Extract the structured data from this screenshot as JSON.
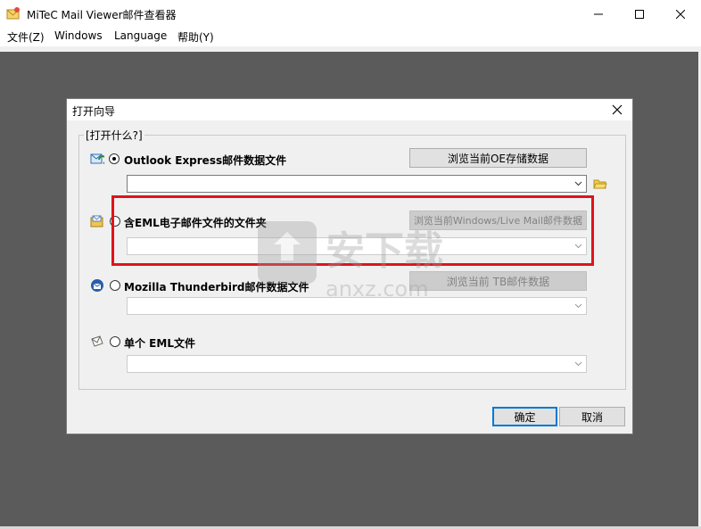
{
  "window": {
    "title": "MiTeC Mail Viewer邮件查看器"
  },
  "menu": {
    "items": [
      "文件(Z)",
      "Windows",
      "Language",
      "帮助(Y)"
    ]
  },
  "dialog": {
    "title": "打开向导",
    "group_label": "[打开什么?]",
    "options": [
      {
        "label": "Outlook Express邮件数据文件",
        "browse_label": "浏览当前OE存储数据",
        "selected": true,
        "enabled": true,
        "icon": "outlook-express-icon"
      },
      {
        "label": "含EML电子邮件文件的文件夹",
        "browse_label": "浏览当前Windows/Live Mail邮件数据",
        "selected": false,
        "enabled": false,
        "icon": "folder-mail-icon"
      },
      {
        "label": "Mozilla Thunderbird邮件数据文件",
        "browse_label": "浏览当前 TB邮件数据",
        "selected": false,
        "enabled": false,
        "icon": "thunderbird-icon"
      },
      {
        "label": "单个 EML文件",
        "selected": false,
        "enabled": false,
        "icon": "eml-file-icon"
      }
    ],
    "ok_label": "确定",
    "cancel_label": "取消"
  },
  "watermark": {
    "text_cn": "安下载",
    "text_en": "anxz.com"
  },
  "colors": {
    "mdi_background": "#5b5b5b",
    "highlight_border": "#e0131b",
    "default_button_border": "#0078d7"
  }
}
